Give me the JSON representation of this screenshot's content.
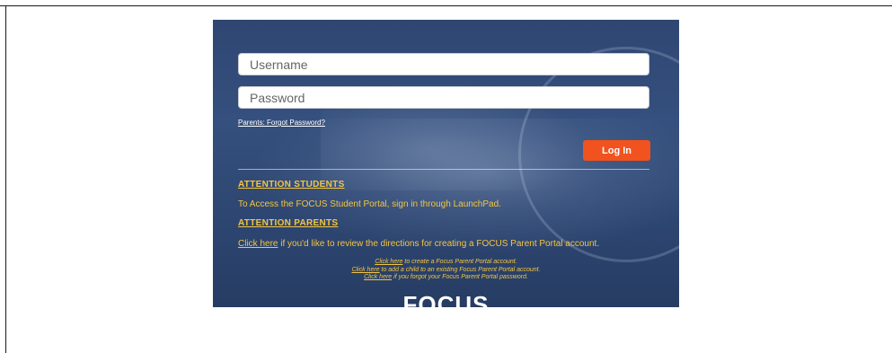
{
  "login": {
    "username_placeholder": "Username",
    "password_placeholder": "Password",
    "forgot_password_label": "Parents: Forgot Password?",
    "login_button_label": "Log In"
  },
  "students": {
    "heading": "ATTENTION STUDENTS",
    "text": "To Access the FOCUS Student Portal, sign in through LaunchPad."
  },
  "parents": {
    "heading": "ATTENTION PARENTS",
    "link_label": "Click here",
    "link_suffix": " if you'd like to review the directions for creating a FOCUS Parent Portal account."
  },
  "small_links": [
    {
      "link": "Click here",
      "text": " to create a Focus Parent Portal account."
    },
    {
      "link": "Click here",
      "text": " to add a child to an existing Focus Parent Portal account."
    },
    {
      "link": "Click here",
      "text": " if you forgot your Focus Parent Portal password."
    }
  ],
  "logo": {
    "text": "FOCUS"
  },
  "colors": {
    "panel_blue": "#2f4672",
    "login_button": "#f2521e",
    "attention_yellow": "#f4c542"
  }
}
